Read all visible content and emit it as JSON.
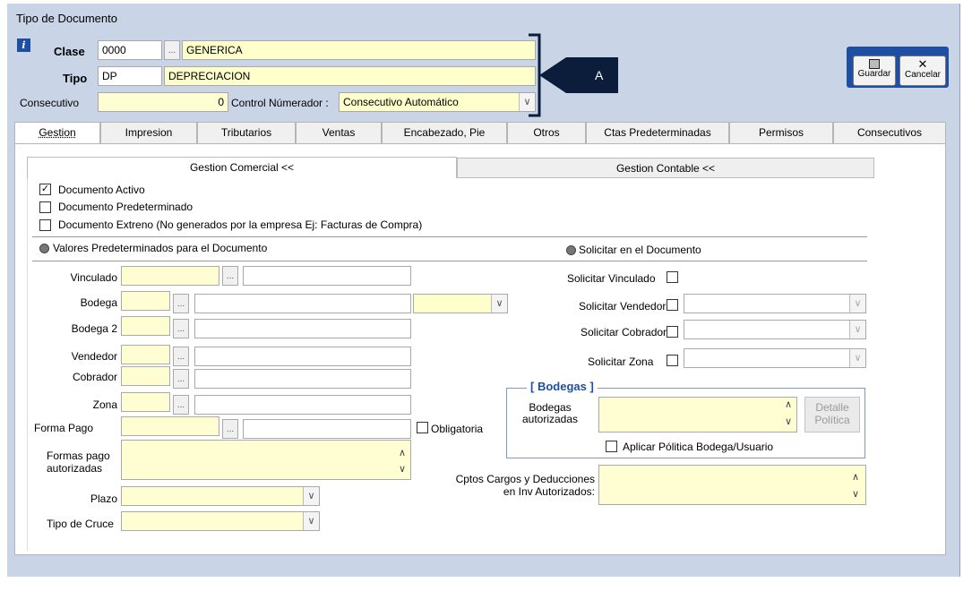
{
  "window": {
    "title": "Tipo de Documento"
  },
  "header": {
    "clase_label": "Clase",
    "clase_code": "0000",
    "clase_name": "GENERICA",
    "tipo_label": "Tipo",
    "tipo_code": "DP",
    "tipo_name": "DEPRECIACION",
    "consecutivo_label": "Consecutivo",
    "consecutivo_value": "0",
    "control_label": "Control Númerador :",
    "control_value": "Consecutivo Automático",
    "ellipsis": "...",
    "annotation": "A"
  },
  "toolbar": {
    "guardar_label": "Guardar",
    "cancelar_label": "Cancelar"
  },
  "tabs": [
    {
      "label": "Gestion"
    },
    {
      "label": "Impresion"
    },
    {
      "label": "Tributarios"
    },
    {
      "label": "Ventas"
    },
    {
      "label": "Encabezado, Pie"
    },
    {
      "label": "Otros"
    },
    {
      "label": "Ctas Predeterminadas"
    },
    {
      "label": "Permisos"
    },
    {
      "label": "Consecutivos"
    }
  ],
  "subtabs": {
    "comercial": "Gestion Comercial <<",
    "contable": "Gestion Contable <<"
  },
  "checks": {
    "activo": "Documento Activo",
    "predeterminado": "Documento Predeterminado",
    "externo": "Documento Extreno (No generados por la empresa  Ej: Facturas de Compra)"
  },
  "sections": {
    "valores": "Valores Predeterminados para el Documento",
    "solicitar": "Solicitar en el Documento",
    "bodegas": "[ Bodegas ]"
  },
  "left": {
    "vinculado": "Vinculado",
    "bodega": "Bodega",
    "bodega2": "Bodega 2",
    "vendedor": "Vendedor",
    "cobrador": "Cobrador",
    "zona": "Zona",
    "forma_pago": "Forma Pago",
    "obligatoria": "Obligatoria",
    "formas_pago_l1": "Formas pago",
    "formas_pago_l2": "autorizadas",
    "plazo": "Plazo",
    "tipo_cruce": "Tipo de Cruce"
  },
  "right": {
    "sol_vinculado": "Solicitar Vinculado",
    "sol_vendedor": "Solicitar Vendedor",
    "sol_cobrador": "Solicitar Cobrador",
    "sol_zona": "Solicitar Zona",
    "bodegas_l1": "Bodegas",
    "bodegas_l2": "autorizadas",
    "detalle_l1": "Detalle",
    "detalle_l2": "Política",
    "aplicar": "Aplicar Pólitica Bodega/Usuario",
    "cptos_l1": "Cptos Cargos y Deducciones",
    "cptos_l2": "en Inv Autorizados:"
  },
  "colors": {
    "frame": "#c9d5e6",
    "yellow_field": "#fffed3",
    "bracket": "#0b1d3a"
  }
}
